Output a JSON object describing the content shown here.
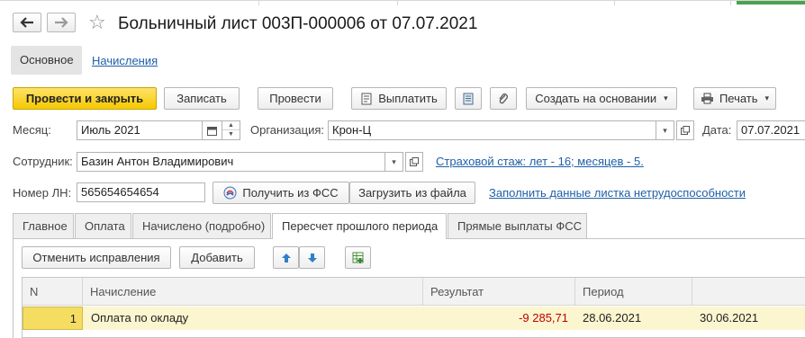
{
  "window": {
    "title": "Больничный лист 003П-000006 от 07.07.2021"
  },
  "nav": {
    "back_icon": "arrow-left-icon",
    "forward_icon": "arrow-right-icon",
    "favorite_icon": "star-icon"
  },
  "sections": {
    "main": "Основное",
    "accruals": "Начисления"
  },
  "toolbar": {
    "post_close": "Провести и закрыть",
    "save": "Записать",
    "post": "Провести",
    "pay": "Выплатить",
    "create_based": "Создать на основании",
    "print": "Печать"
  },
  "form": {
    "month_label": "Месяц:",
    "month_value": "Июль 2021",
    "org_label": "Организация:",
    "org_value": "Крон-Ц",
    "date_label": "Дата:",
    "date_value": "07.07.2021",
    "employee_label": "Сотрудник:",
    "employee_value": "Базин Антон Владимирович",
    "insurance_link": "Страховой стаж: лет - 16; месяцев - 5.",
    "ln_label": "Номер ЛН:",
    "ln_value": "565654654654",
    "get_fss": "Получить из ФСС",
    "load_file": "Загрузить из файла",
    "fill_link": "Заполнить данные листка нетрудоспособности"
  },
  "tabs": [
    {
      "label": "Главное"
    },
    {
      "label": "Оплата"
    },
    {
      "label": "Начислено (подробно)"
    },
    {
      "label": "Пересчет прошлого периода"
    },
    {
      "label": "Прямые выплаты ФСС"
    }
  ],
  "tab_toolbar": {
    "cancel_fixes": "Отменить исправления",
    "add": "Добавить"
  },
  "table": {
    "columns": [
      "N",
      "Начисление",
      "Результат",
      "Период",
      ""
    ],
    "rows": [
      {
        "n": "1",
        "accrual": "Оплата по окладу",
        "result": "-9 285,71",
        "period": "28.06.2021",
        "end": "30.06.2021"
      }
    ]
  },
  "colors": {
    "accent_yellow": "#f5c900",
    "link": "#1f5fa8",
    "negative": "#c00000",
    "row_highlight": "#fbf6cf"
  }
}
